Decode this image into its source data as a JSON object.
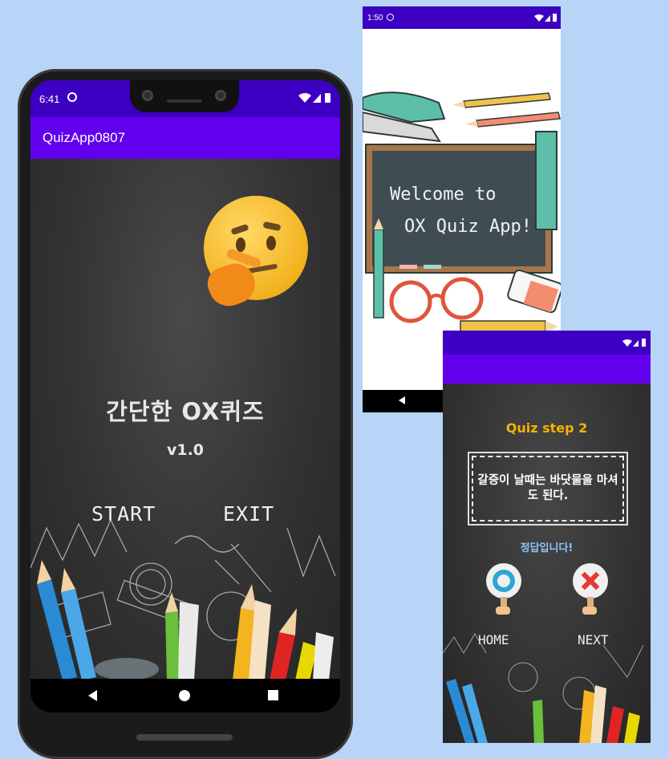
{
  "main_phone": {
    "status_time": "6:41",
    "app_title": "QuizApp0807",
    "title": "간단한 OX퀴즈",
    "version": "v1.0",
    "start_label": "START",
    "exit_label": "EXIT"
  },
  "splash_phone": {
    "status_time": "1:50",
    "welcome_line1": "Welcome to",
    "welcome_line2": "OX Quiz App!"
  },
  "quiz_phone": {
    "step_label": "Quiz step 2",
    "question": "갈증이 날때는 바닷물을 마셔도 된다.",
    "result": "정답입니다!",
    "home_label": "HOME",
    "next_label": "NEXT"
  },
  "colors": {
    "status_bar": "#3d00c2",
    "app_bar": "#6200ee",
    "background": "#b8d4f7",
    "accent_yellow": "#f4b400",
    "result_blue": "#8fc6ff"
  },
  "icons": [
    "wifi-icon",
    "signal-icon",
    "battery-icon",
    "back-icon",
    "home-icon",
    "recents-icon",
    "thinking-face-icon",
    "o-sign-icon",
    "x-sign-icon"
  ]
}
